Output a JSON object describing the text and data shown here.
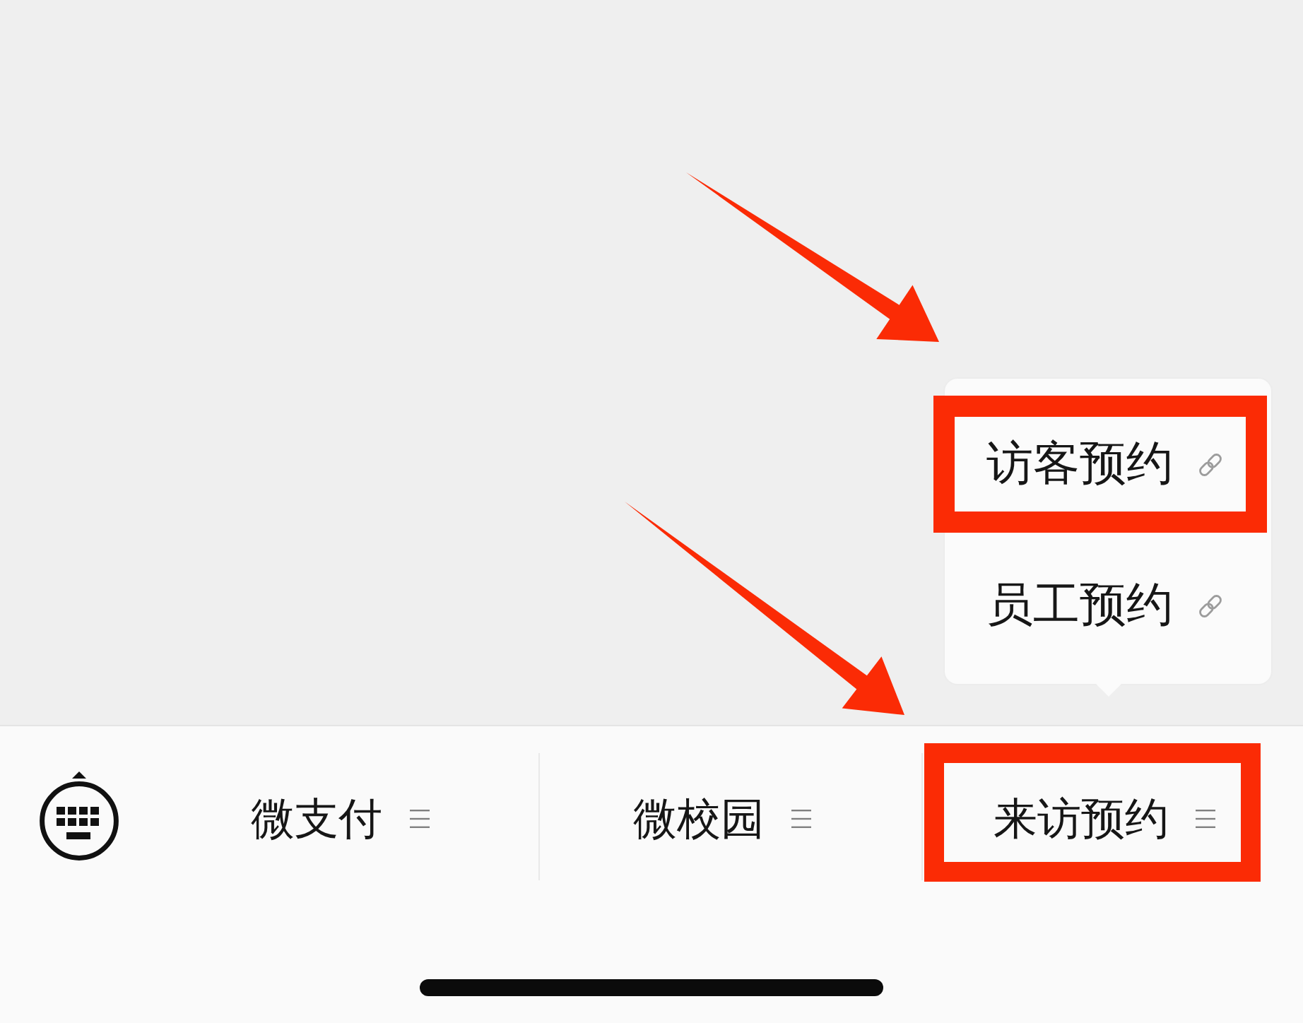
{
  "menu_bar": {
    "items": [
      {
        "label": "微支付",
        "expanded": false,
        "highlighted": false
      },
      {
        "label": "微校园",
        "expanded": false,
        "highlighted": false
      },
      {
        "label": "来访预约",
        "expanded": true,
        "highlighted": true,
        "submenu": [
          {
            "label": "访客预约",
            "highlighted": true
          },
          {
            "label": "员工预约",
            "highlighted": false
          }
        ]
      }
    ]
  }
}
